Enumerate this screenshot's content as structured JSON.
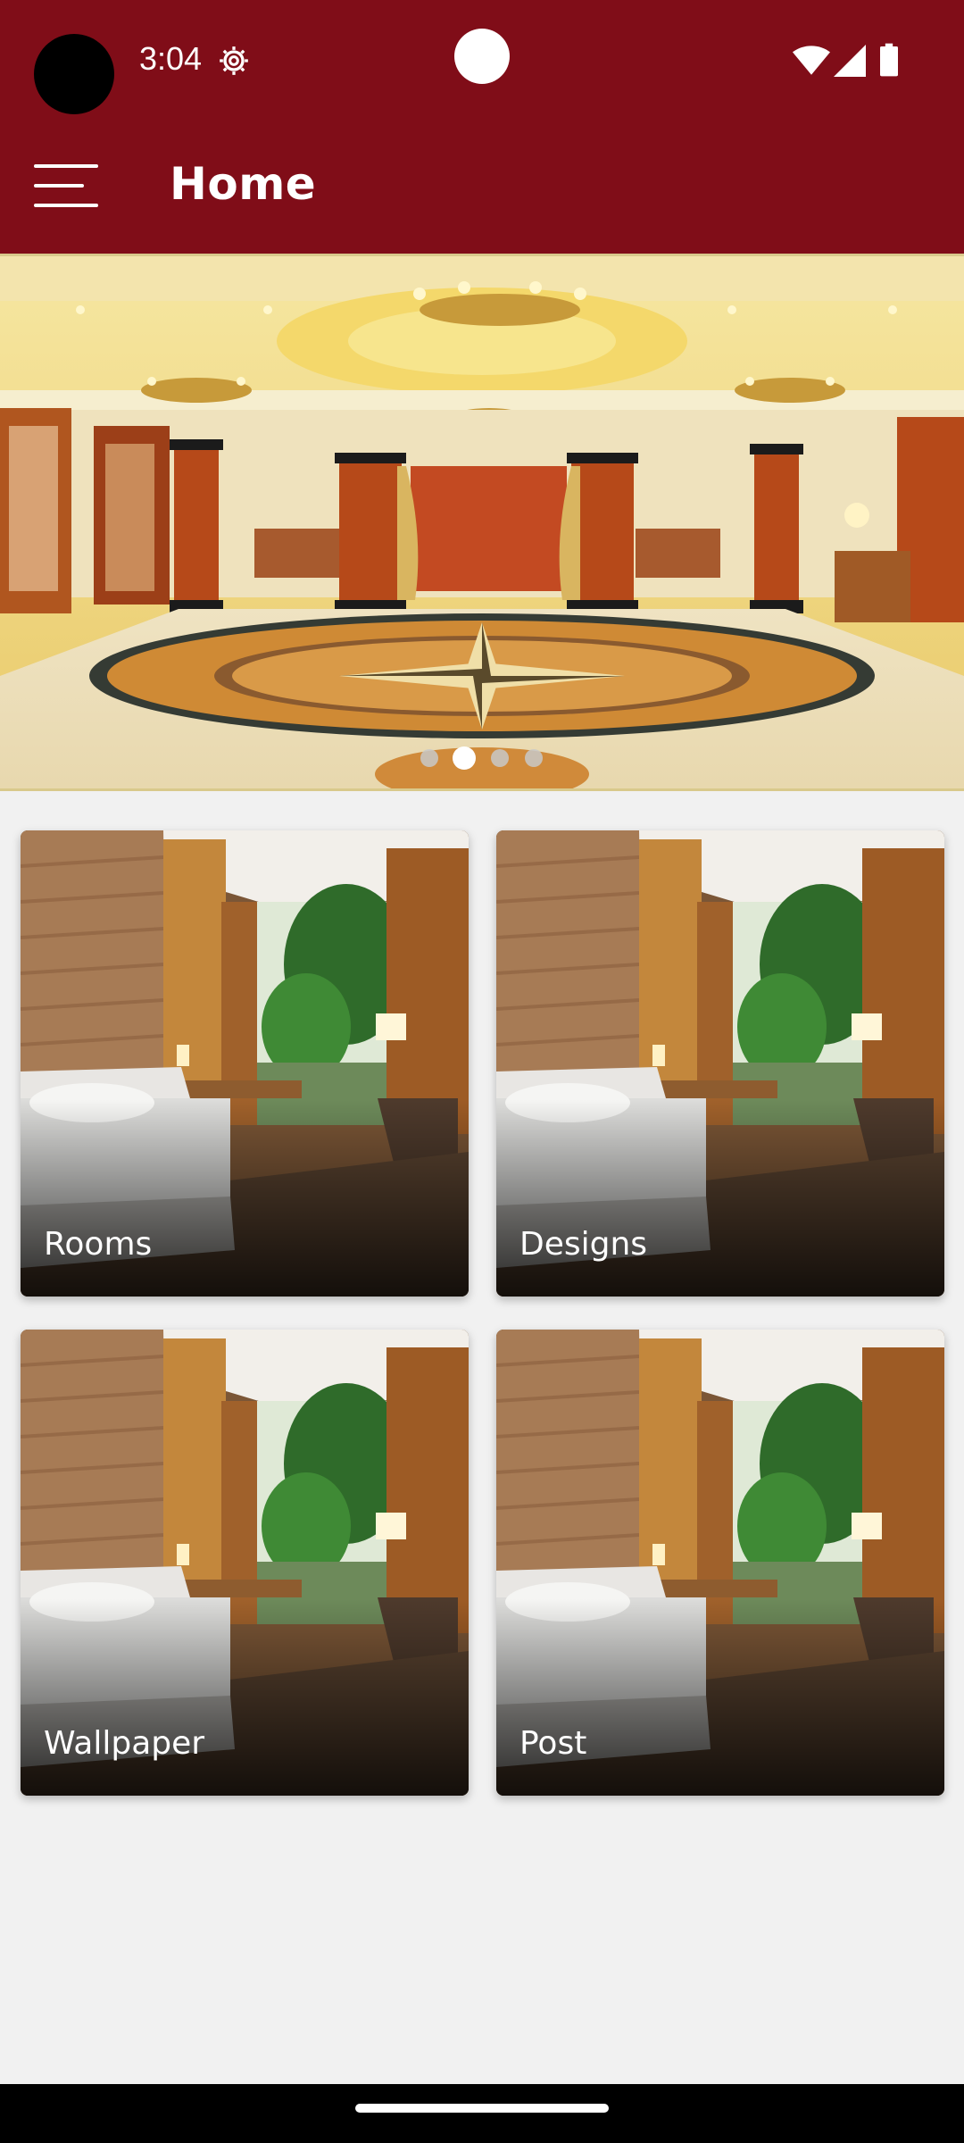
{
  "status_bar": {
    "time": "3:04",
    "icons": [
      "settings-gear-icon",
      "wifi-icon",
      "cellular-signal-icon",
      "battery-icon"
    ]
  },
  "app_bar": {
    "title": "Home",
    "menu_icon": "hamburger-menu-icon",
    "background_color": "#800d18"
  },
  "carousel": {
    "image": "banquet-hall-photo",
    "slide_count": 4,
    "active_index": 1
  },
  "grid": {
    "items": [
      {
        "label": "Rooms",
        "image": "hotel-room-photo"
      },
      {
        "label": "Designs",
        "image": "hotel-room-photo"
      },
      {
        "label": "Wallpaper",
        "image": "hotel-room-photo"
      },
      {
        "label": "Post",
        "image": "hotel-room-photo"
      }
    ]
  },
  "colors": {
    "page_background": "#f1f1f1",
    "nav_bar": "#000000"
  }
}
